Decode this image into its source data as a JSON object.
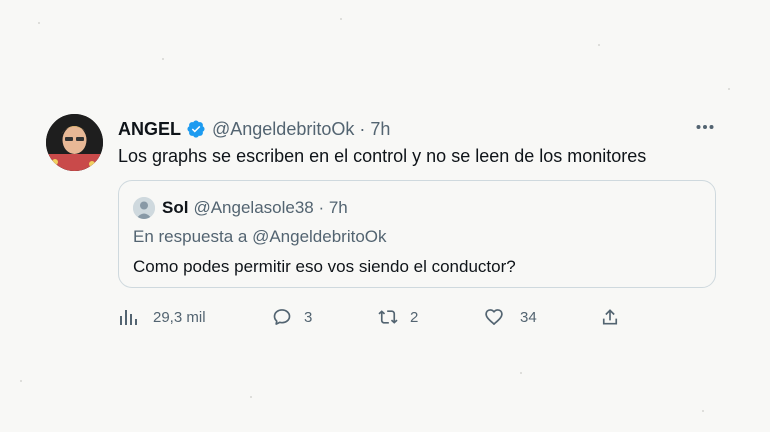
{
  "tweet": {
    "author_name": "ANGEL",
    "handle_time": "@AngeldebritoOk · 7h",
    "text": "Los graphs se escriben en el control y no se leen de los monitores"
  },
  "quoted": {
    "author_name": "Sol",
    "handle_time": "@Angelasole38 · 7h",
    "reply_to": "En respuesta a @AngeldebritoOk",
    "text": "Como podes permitir eso vos siendo el conductor?"
  },
  "actions": {
    "views": "29,3 mil",
    "replies": "3",
    "retweets": "2",
    "likes": "34"
  },
  "colors": {
    "verified_blue": "#1d9bf0",
    "secondary_text": "#536471",
    "border": "#cfd9de"
  },
  "icons": [
    "verified-badge-icon",
    "more-icon",
    "views-icon",
    "reply-icon",
    "retweet-icon",
    "like-icon",
    "share-icon"
  ]
}
